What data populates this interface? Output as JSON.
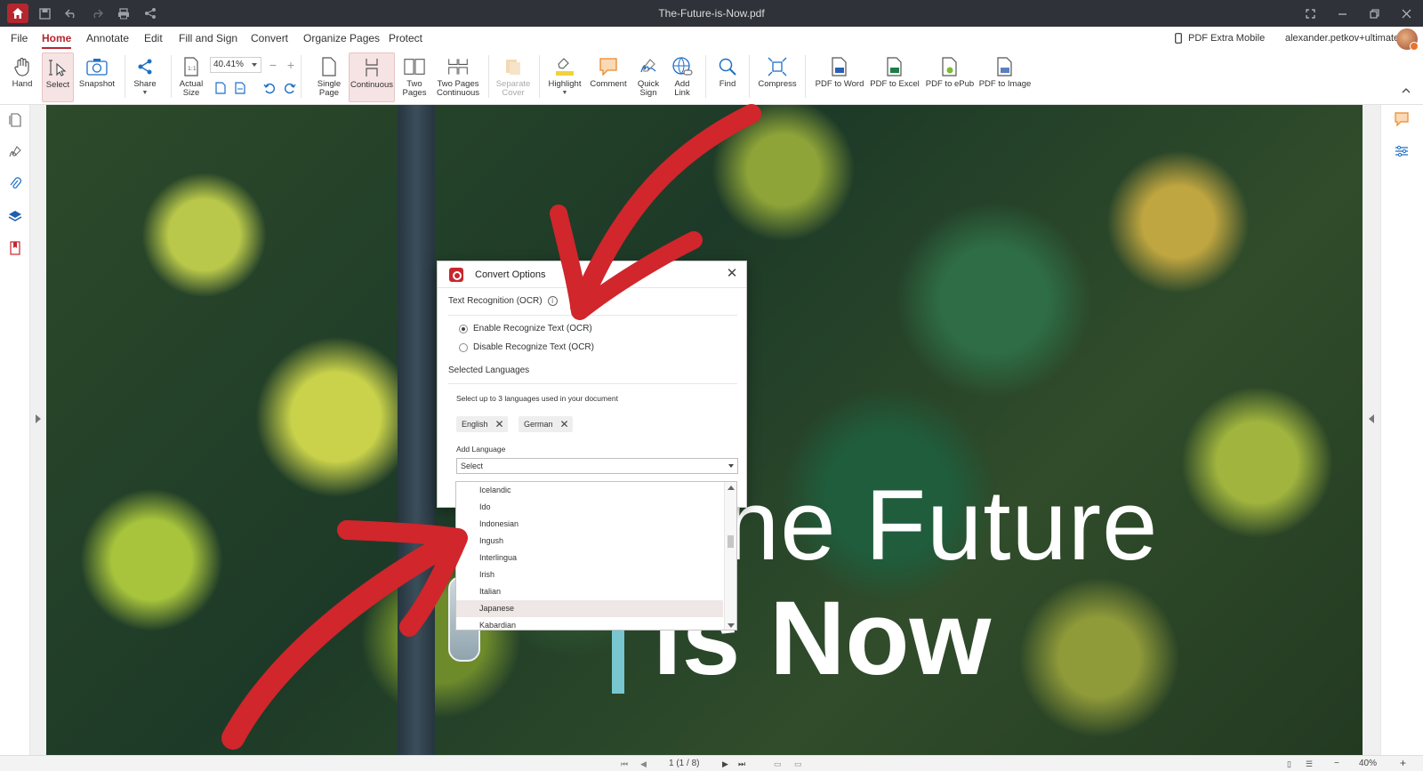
{
  "window": {
    "title": "The-Future-is-Now.pdf"
  },
  "menu": {
    "items": [
      "File",
      "Home",
      "Annotate",
      "Edit",
      "Fill and Sign",
      "Convert",
      "Organize Pages",
      "Protect"
    ],
    "active": "Home",
    "mobile_label": "PDF Extra Mobile",
    "user": "alexander.petkov+ultimate"
  },
  "toolbar": {
    "hand": "Hand",
    "select": "Select",
    "snapshot": "Snapshot",
    "share": "Share",
    "actual_size_1": "Actual",
    "actual_size_2": "Size",
    "zoom_value": "40.41%",
    "single_page_1": "Single",
    "single_page_2": "Page",
    "continuous": "Continuous",
    "two_pages_1": "Two",
    "two_pages_2": "Pages",
    "two_pages_cont_1": "Two Pages",
    "two_pages_cont_2": "Continuous",
    "separate_cover_1": "Separate",
    "separate_cover_2": "Cover",
    "highlight": "Highlight",
    "comment": "Comment",
    "quick_sign_1": "Quick",
    "quick_sign_2": "Sign",
    "add_link_1": "Add",
    "add_link_2": "Link",
    "find": "Find",
    "compress": "Compress",
    "pdf_to_word": "PDF to Word",
    "pdf_to_excel": "PDF to Excel",
    "pdf_to_epub": "PDF to ePub",
    "pdf_to_image": "PDF to Image"
  },
  "document": {
    "line1": "he Future",
    "line2": "is Now"
  },
  "dialog": {
    "title": "Convert Options",
    "ocr_section": "Text Recognition (OCR)",
    "info_glyph": "i",
    "enable_ocr": "Enable Recognize Text (OCR)",
    "disable_ocr": "Disable Recognize Text (OCR)",
    "languages_section": "Selected Languages",
    "languages_hint": "Select up to 3 languages used in your document",
    "chips": [
      "English",
      "German"
    ],
    "add_language": "Add Language",
    "select_placeholder": "Select",
    "dropdown_items": [
      "Icelandic",
      "Ido",
      "Indonesian",
      "Ingush",
      "Interlingua",
      "Irish",
      "Italian",
      "Japanese",
      "Kabardian"
    ],
    "highlighted_item": "Japanese"
  },
  "status": {
    "page_indicator": "1 (1 / 8)",
    "zoom": "40%"
  },
  "colors": {
    "accent": "#b5262e",
    "titlebar": "#2f3238",
    "arrow": "#d0262c"
  }
}
